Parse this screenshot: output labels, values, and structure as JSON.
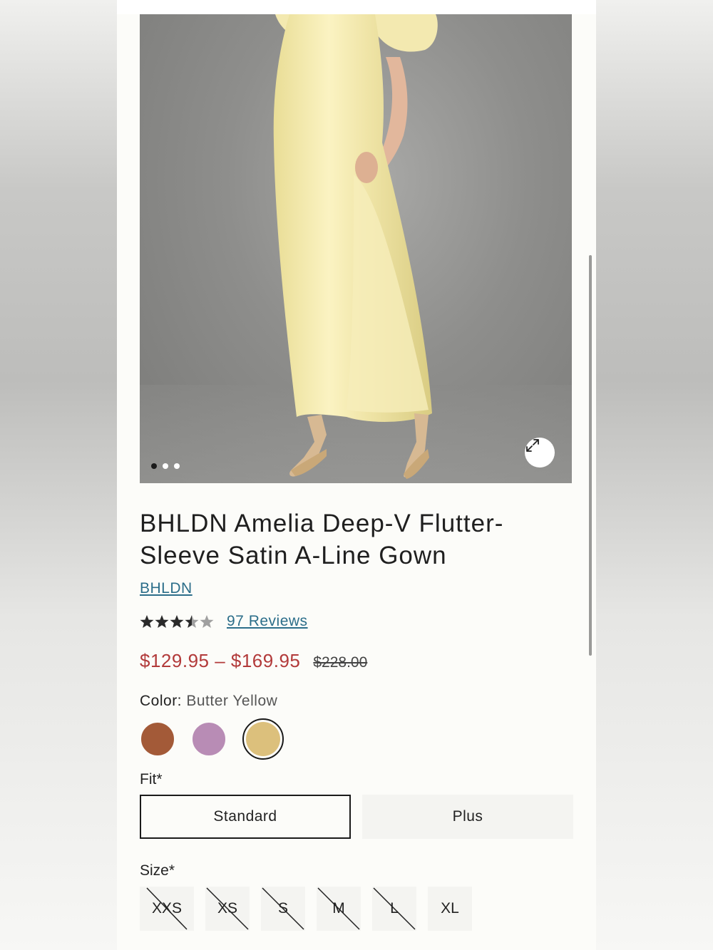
{
  "product": {
    "title": "BHLDN Amelia Deep-V Flutter-Sleeve Satin A-Line Gown",
    "brand": "BHLDN",
    "rating": 3.5,
    "rating_max": 5,
    "reviews": "97 Reviews",
    "price_range": "$129.95 – $169.95",
    "original_price": "$228.00"
  },
  "gallery": {
    "total_images": 3,
    "current_index": 1,
    "expand_icon": "expand-icon"
  },
  "color": {
    "label": "Color:",
    "selected_name": "Butter Yellow",
    "swatches": [
      {
        "color": "#a35a38",
        "selected": false
      },
      {
        "color": "#b88cb5",
        "selected": false
      },
      {
        "color": "#dcc07c",
        "selected": true
      }
    ]
  },
  "fit": {
    "label": "Fit*",
    "options": [
      {
        "label": "Standard",
        "selected": true
      },
      {
        "label": "Plus",
        "selected": false
      }
    ]
  },
  "size": {
    "label": "Size*",
    "options": [
      {
        "label": "XXS",
        "available": false
      },
      {
        "label": "XS",
        "available": false
      },
      {
        "label": "S",
        "available": false
      },
      {
        "label": "M",
        "available": false
      },
      {
        "label": "L",
        "available": false
      },
      {
        "label": "XL",
        "available": true
      }
    ]
  },
  "colors": {
    "price_sale": "#b23a3a",
    "link": "#2c6e8a"
  }
}
